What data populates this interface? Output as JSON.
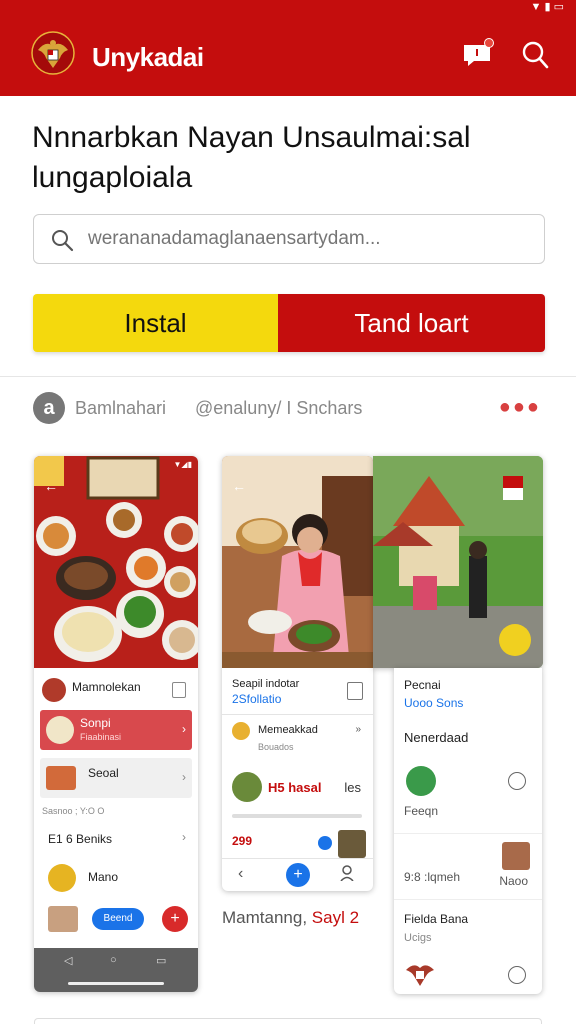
{
  "app": {
    "title": "Unykadai",
    "headline": "Nnnarbkan Nayan Unsaulmai:sal lungaploiala"
  },
  "search": {
    "placeholder": "werananadamaglanaensartydam..."
  },
  "buttons": {
    "install_label": "Instal",
    "secondary_label": "Tand loart"
  },
  "developer": {
    "avatar_letter": "a",
    "name": "Bamlnahari",
    "handle": "@enaluny/ I Snchars"
  },
  "screenshot1": {
    "header": "Mamnolekan",
    "items": [
      {
        "title": "Sonpi",
        "sub": "Fiaabinasi"
      },
      {
        "title": "Seoal",
        "sub": "Sasnoo ; Y:O O"
      },
      {
        "title": "E1 6 Beniks",
        "sub": ""
      },
      {
        "title": "Mano",
        "sub": ""
      }
    ],
    "pill": "Beend"
  },
  "screenshot2": {
    "header_title": "Seapil indotar",
    "header_sub": "2Sfollatio",
    "item1": "Memeakkad",
    "item1_sub": "Bouados",
    "item2": "H5 hasal",
    "item2_right": "les",
    "price": "299"
  },
  "screenshot3": {
    "header_title": "Pecnai",
    "header_sub": "Uooo Sons",
    "item1": "Nenerdaad",
    "item2": "Feeqn",
    "item3": "9:8 :lqmeh",
    "item3_right": "Naoo",
    "item4": "Fielda Bana",
    "item4_sub": "Ucigs"
  },
  "caption": {
    "text": "Mamtanng,",
    "red": "Sayl 2"
  },
  "colors": {
    "brand_red": "#c40d0d",
    "brand_yellow": "#f4d90d",
    "accent_blue": "#1a73e8"
  }
}
